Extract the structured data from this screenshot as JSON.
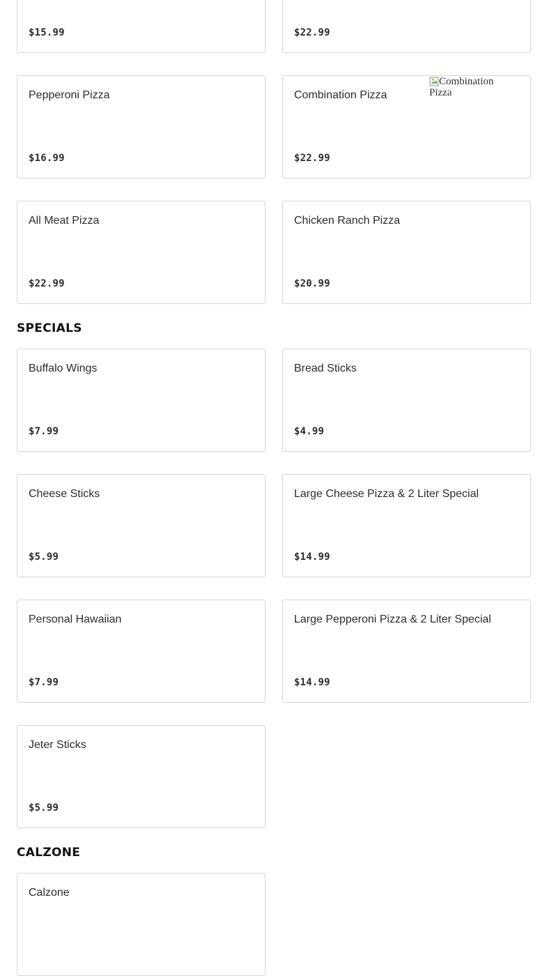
{
  "menu": {
    "top_row": {
      "left_price": "$15.99",
      "right_price": "$22.99"
    },
    "pizza_items": [
      {
        "name": "Pepperoni Pizza",
        "price": "$16.99"
      },
      {
        "name": "Combination Pizza",
        "price": "$22.99",
        "image_alt": "Combination Pizza"
      },
      {
        "name": "All Meat Pizza",
        "price": "$22.99"
      },
      {
        "name": "Chicken Ranch Pizza",
        "price": "$20.99"
      }
    ],
    "specials": {
      "title": "SPECIALS",
      "items": [
        {
          "name": "Buffalo Wings",
          "price": "$7.99"
        },
        {
          "name": "Bread Sticks",
          "price": "$4.99"
        },
        {
          "name": "Cheese Sticks",
          "price": "$5.99"
        },
        {
          "name": "Large Cheese Pizza & 2 Liter Special",
          "price": "$14.99"
        },
        {
          "name": "Personal Hawaiian",
          "price": "$7.99"
        },
        {
          "name": "Large Pepperoni Pizza & 2 Liter Special",
          "price": "$14.99"
        },
        {
          "name": "Jeter Sticks",
          "price": "$5.99"
        }
      ]
    },
    "calzone": {
      "title": "CALZONE",
      "items": [
        {
          "name": "Calzone"
        }
      ]
    }
  },
  "colors": {
    "card_border": "#d6d6d6",
    "text": "#2b2b2b",
    "heading": "#111111",
    "background": "#ffffff"
  }
}
